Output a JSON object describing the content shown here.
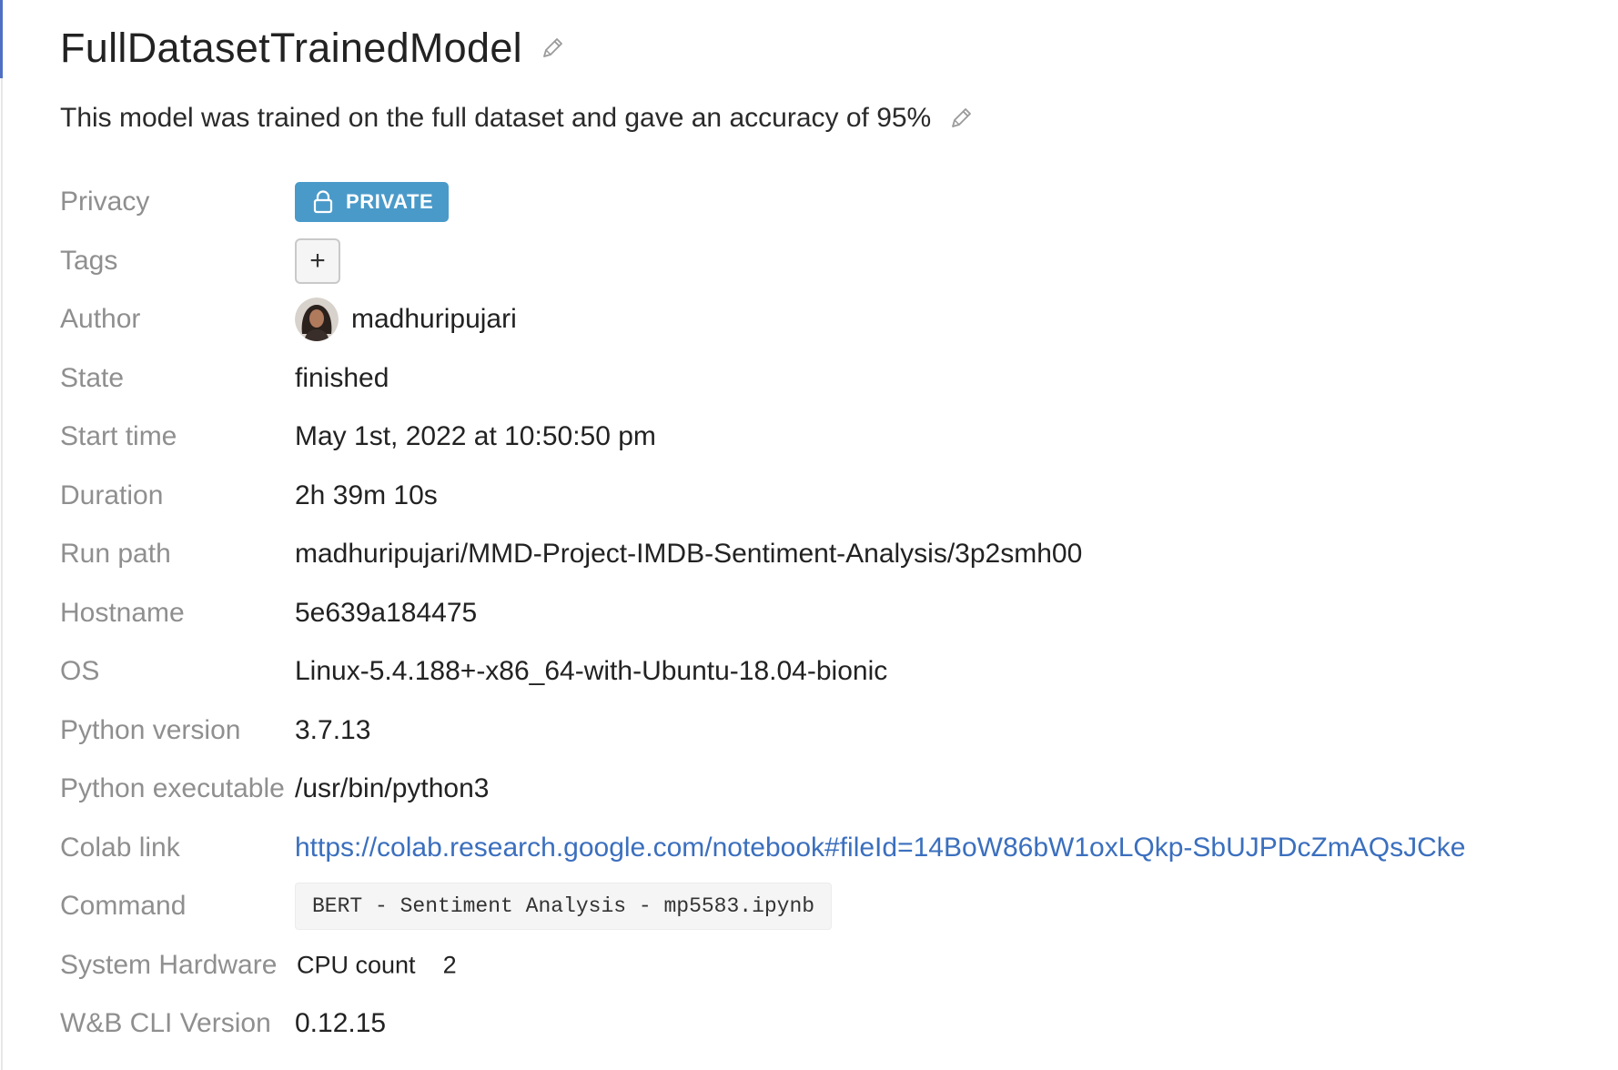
{
  "run": {
    "name": "FullDatasetTrainedModel",
    "description": "This model was trained on the full dataset and gave an accuracy of 95%"
  },
  "icons": {
    "edit": "pencil-icon",
    "lock": "lock-icon",
    "add": "plus-icon"
  },
  "colors": {
    "accent": "#4f6fc4",
    "privacy_badge": "#4a9ac9",
    "link": "#3b6fbe",
    "label": "#8f8f8f"
  },
  "fields": {
    "privacy": {
      "label": "Privacy",
      "value": "PRIVATE"
    },
    "tags": {
      "label": "Tags",
      "add_label": "+"
    },
    "author": {
      "label": "Author",
      "value": "madhuripujari"
    },
    "state": {
      "label": "State",
      "value": "finished"
    },
    "start_time": {
      "label": "Start time",
      "value": "May 1st, 2022 at 10:50:50 pm"
    },
    "duration": {
      "label": "Duration",
      "value": "2h 39m 10s"
    },
    "run_path": {
      "label": "Run path",
      "value": "madhuripujari/MMD-Project-IMDB-Sentiment-Analysis/3p2smh00"
    },
    "hostname": {
      "label": "Hostname",
      "value": "5e639a184475"
    },
    "os": {
      "label": "OS",
      "value": "Linux-5.4.188+-x86_64-with-Ubuntu-18.04-bionic"
    },
    "python_version": {
      "label": "Python version",
      "value": "3.7.13"
    },
    "python_executable": {
      "label": "Python executable",
      "value": "/usr/bin/python3"
    },
    "colab_link": {
      "label": "Colab link",
      "value": "https://colab.research.google.com/notebook#fileId=14BoW86bW1oxLQkp-SbUJPDcZmAQsJCke"
    },
    "command": {
      "label": "Command",
      "value": "BERT - Sentiment Analysis - mp5583.ipynb"
    },
    "system_hardware": {
      "label": "System Hardware",
      "key": "CPU count",
      "value": "2"
    },
    "wandb_cli_version": {
      "label": "W&B CLI Version",
      "value": "0.12.15"
    }
  }
}
